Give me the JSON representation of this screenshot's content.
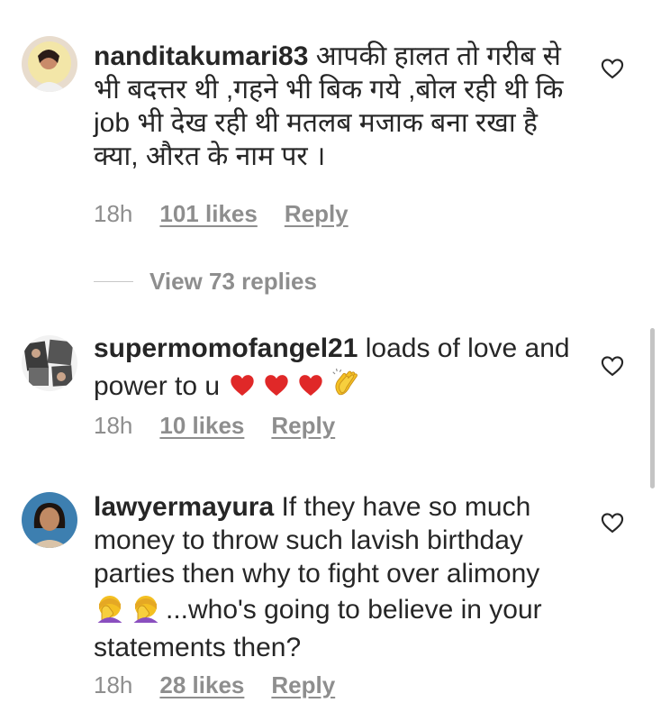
{
  "comments": [
    {
      "username": "nanditakumari83",
      "text": " आपकी हालत तो गरीब से भी बदत्तर थी ,गहने भी बिक गये ,बोल रही थी कि job भी देख रही थी  मतलब मजाक बना रखा है क्या, औरत के नाम पर ।",
      "time": "18h",
      "likes": "101 likes",
      "reply": "Reply"
    },
    {
      "username": "supermomofangel21",
      "text": " loads of love and power to u",
      "emojis": [
        "red-heart",
        "red-heart",
        "red-heart",
        "clapping-hands"
      ],
      "time": "18h",
      "likes": "10 likes",
      "reply": "Reply"
    },
    {
      "username": "lawyermayura",
      "text_before": " If they have so much money to throw such lavish birthday parties then why to fight over alimony ",
      "emojis": [
        "face-palm",
        "face-palm"
      ],
      "text_after": "...who's going to believe in your statements then?",
      "time": "18h",
      "likes": "28 likes",
      "reply": "Reply"
    }
  ],
  "view_replies": "View 73 replies",
  "colors": {
    "text": "#262626",
    "meta": "#8e8e8e",
    "heart_red": "#e02828",
    "emoji_yellow": "#f4c022"
  }
}
